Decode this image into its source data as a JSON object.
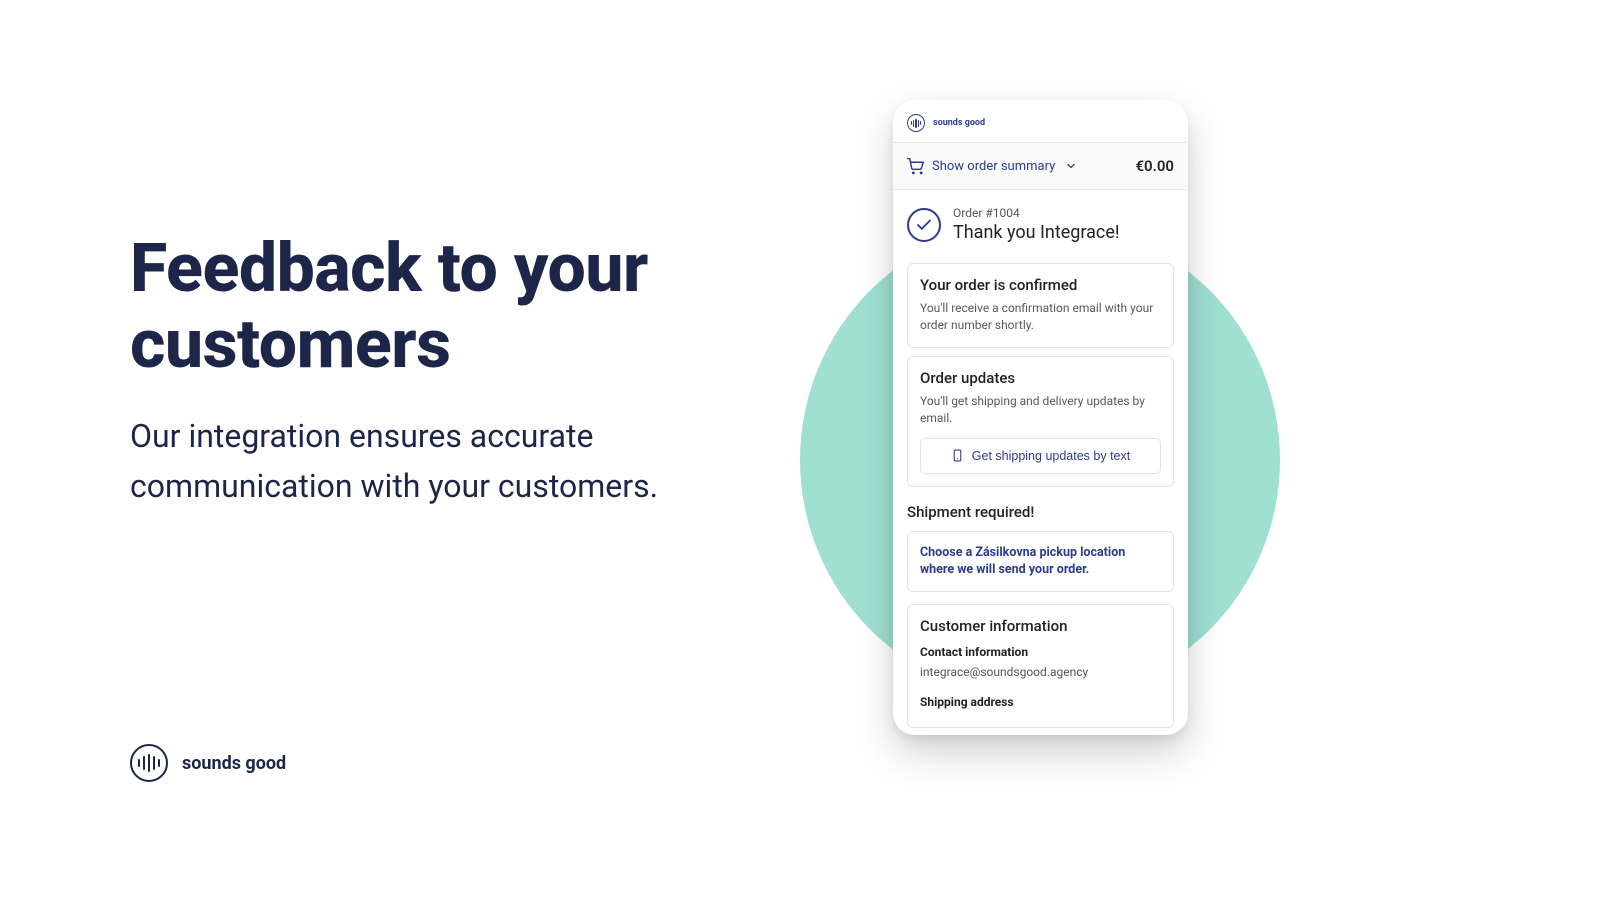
{
  "headline": "Feedback to your customers",
  "subheadline": "Our integration ensures accurate communication with your customers.",
  "brand": {
    "name": "sounds good"
  },
  "phone": {
    "brand": {
      "name": "sounds good"
    },
    "summary": {
      "toggle_label": "Show order summary",
      "total": "€0.00"
    },
    "thanks": {
      "order_label": "Order #1004",
      "thank_you": "Thank you Integrace!"
    },
    "confirmed": {
      "title": "Your order is confirmed",
      "body": "You'll receive a confirmation email with your order number shortly."
    },
    "updates": {
      "title": "Order updates",
      "body": "You'll get shipping and delivery updates by email.",
      "button": "Get shipping updates by text"
    },
    "shipment": {
      "title": "Shipment required!",
      "instruction": "Choose a Zásilkovna pickup location where we will send your order."
    },
    "customer": {
      "title": "Customer information",
      "contact_label": "Contact information",
      "contact_value": "integrace@soundsgood.agency",
      "shipping_label": "Shipping address"
    }
  }
}
